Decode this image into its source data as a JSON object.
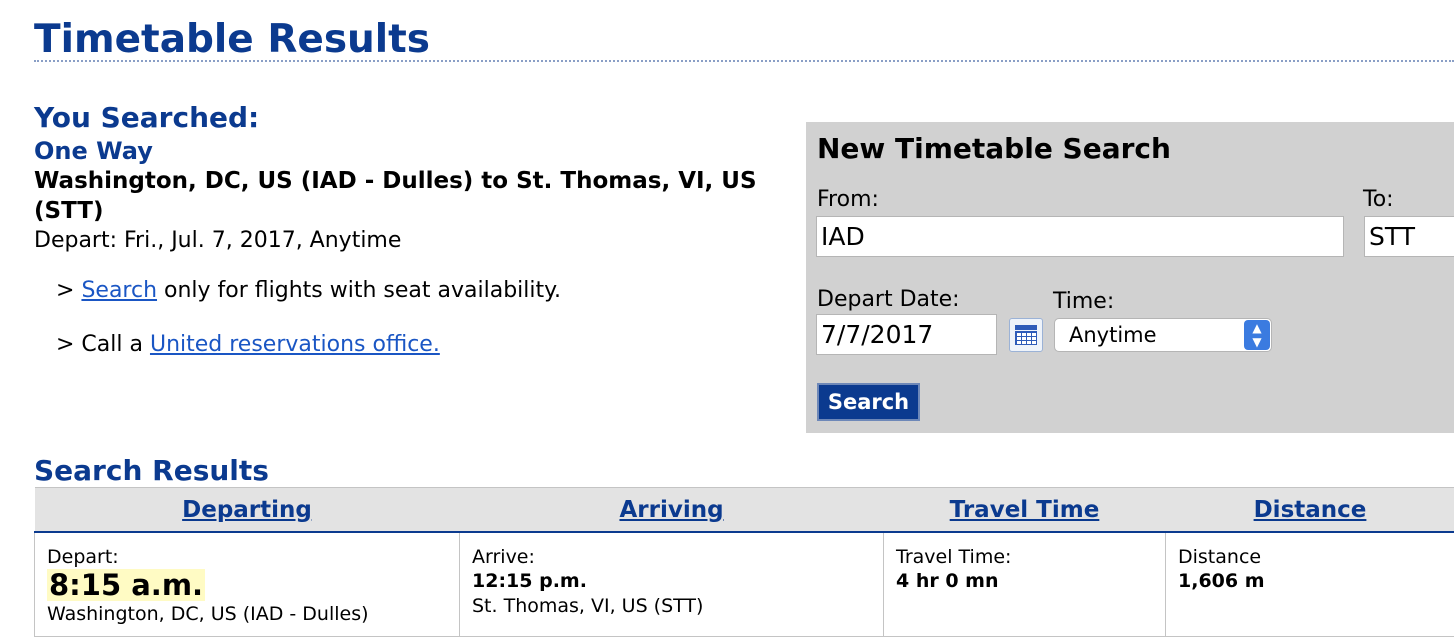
{
  "page": {
    "title": "Timetable Results"
  },
  "searched": {
    "heading": "You Searched:",
    "trip_type": "One Way",
    "route": "Washington, DC, US (IAD - Dulles) to St. Thomas, VI, US (STT)",
    "depart": "Depart: Fri., Jul. 7, 2017, Anytime",
    "note1": {
      "prefix": "> ",
      "link": "Search",
      "suffix": " only for flights with seat availability."
    },
    "note2": {
      "prefix": "> Call a ",
      "link": "United reservations office."
    }
  },
  "new_search": {
    "title": "New Timetable Search",
    "from_label": "From:",
    "from_value": "IAD",
    "to_label": "To:",
    "to_value": "STT",
    "date_label": "Depart Date:",
    "date_value": "7/7/2017",
    "time_label": "Time:",
    "time_value": "Anytime",
    "search_button": "Search",
    "icons": {
      "calendar": "calendar-icon",
      "select": "select-chevron-icon"
    }
  },
  "results": {
    "heading": "Search Results",
    "columns": [
      "Departing",
      "Arriving",
      "Travel Time",
      "Distance"
    ],
    "rows": [
      {
        "depart_label": "Depart:",
        "depart_time": "8:15 a.m.",
        "depart_place": "Washington, DC, US (IAD - Dulles)",
        "arrive_label": "Arrive:",
        "arrive_time": "12:15 p.m.",
        "arrive_place": "St. Thomas, VI, US (STT)",
        "travel_label": "Travel Time:",
        "travel_value": "4 hr 0 mn",
        "distance_label": "Distance",
        "distance_value": "1,606 m"
      }
    ]
  },
  "colors": {
    "heading_blue": "#0b3a8f",
    "link_blue": "#1a56c4",
    "panel_gray": "#d1d1d1",
    "highlight": "#fffbc4"
  }
}
